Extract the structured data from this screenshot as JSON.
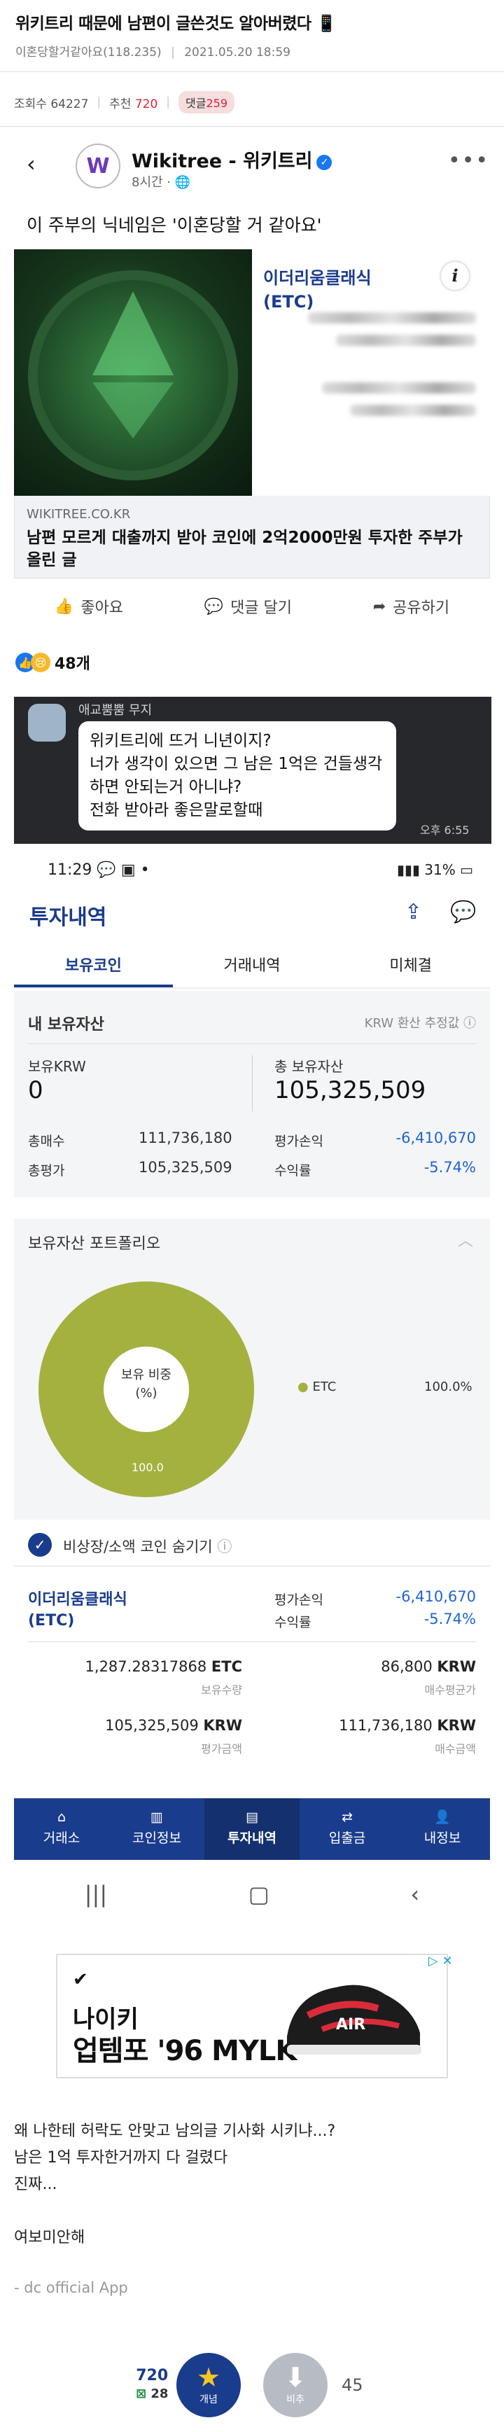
{
  "post": {
    "title": "위키트리 때문에 남편이 글쓴것도 알아버렸다 📱",
    "author": "이혼당할거같아요(118.235)",
    "date": "2021.05.20 18:59",
    "views_label": "조회수 64227",
    "recommend_label": "추천",
    "recommend_count": "720",
    "comment_badge_label": "댓글",
    "comment_badge_count": "259"
  },
  "fb": {
    "page_name": "Wikitree - 위키트리",
    "logo_letter": "W",
    "time": "8시간 · ",
    "text": "이 주부의 닉네임은 '이혼당할 거 같아요'",
    "card_coin_name": "이더리움클래식\n(ETC)",
    "card_domain": "WIKITREE.CO.KR",
    "card_headline": "남편 모르게 대출까지 받아 코인에 2억2000만원 투자한 주부가 올린 글",
    "like": "좋아요",
    "comment": "댓글 달기",
    "share": "공유하기",
    "reaction_count": "48개"
  },
  "chat": {
    "name": "애교뿜뿜 무지",
    "message": "위키트리에 뜨거 니년이지?\n너가 생각이 있으면 그 남은 1억은 건들생각 하면 안되는거 아니냐?\n전화 받아라 좋은말로할때",
    "time": "오후 6:55"
  },
  "phone": {
    "time": "11:29",
    "battery": "31%"
  },
  "app": {
    "title": "투자내역",
    "tabs": [
      "보유코인",
      "거래내역",
      "미체결"
    ],
    "my_assets_label": "내 보유자산",
    "krw_estimate_label": "KRW 환산 추정값",
    "krw_holding_label": "보유KRW",
    "krw_holding_value": "0",
    "total_assets_label": "총 보유자산",
    "total_assets_value": "105,325,509",
    "total_buy_label": "총매수",
    "total_buy_value": "111,736,180",
    "total_eval_label": "총평가",
    "total_eval_value": "105,325,509",
    "eval_pl_label": "평가손익",
    "eval_pl_value": "-6,410,670",
    "return_label": "수익률",
    "return_value": "-5.74%",
    "portfolio_label": "보유자산 포트폴리오",
    "pie_center_label": "보유 비중\n(%)",
    "pie_value_label": "100.0",
    "legend_name": "ETC",
    "legend_pct": "100.0%",
    "hide_label": "비상장/소액 코인 숨기기",
    "coin_name": "이더리움클래식\n(ETC)",
    "coin_pl_label": "평가손익",
    "coin_pl_value": "-6,410,670",
    "coin_return_label": "수익률",
    "coin_return_value": "-5.74%",
    "qty_value": "1,287.28317868",
    "qty_unit": "ETC",
    "qty_label": "보유수량",
    "avg_price_value": "86,800",
    "avg_price_unit": "KRW",
    "avg_price_label": "매수평균가",
    "eval_amount_value": "105,325,509",
    "eval_amount_unit": "KRW",
    "eval_amount_label": "평가금액",
    "buy_amount_value": "111,736,180",
    "buy_amount_unit": "KRW",
    "buy_amount_label": "매수금액",
    "nav": [
      "거래소",
      "코인정보",
      "투자내역",
      "입출금",
      "내정보"
    ],
    "colors": {
      "brand": "#1a3c8c",
      "pie": "#a4b13f",
      "negative": "#1f63d6"
    }
  },
  "ad": {
    "brand": "✔",
    "line1": "나이키",
    "line2": "업템포 '96 MYLK"
  },
  "body": {
    "lines": [
      "왜 나한테 허락도 안맞고 남의글 기사화 시키냐...?",
      "남은 1억 투자한거까지 다 걸렸다",
      "진짜...",
      "",
      "여보미안해"
    ],
    "signature": "- dc official App"
  },
  "vote": {
    "up_count": "720",
    "fixed_count": "28",
    "up_label": "개념",
    "down_label": "비추",
    "down_count": "45"
  }
}
